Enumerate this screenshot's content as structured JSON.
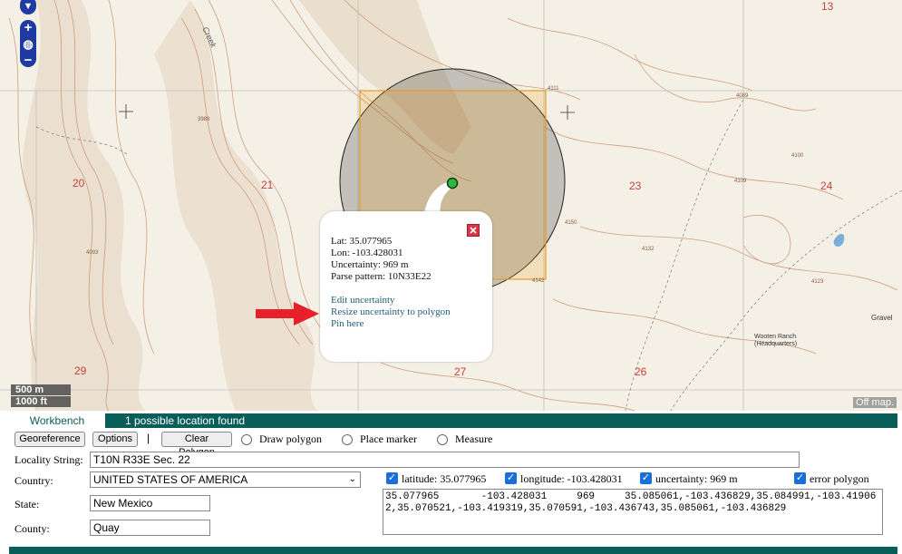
{
  "map": {
    "section_numbers": [
      "13",
      "20",
      "21",
      "23",
      "24",
      "29",
      "27",
      "26"
    ],
    "elevation_labels": [
      "3988",
      "4093",
      "4111",
      "4089",
      "4100",
      "4109",
      "4150",
      "4132",
      "4123",
      "4142"
    ],
    "place_labels": {
      "creek": "Creek",
      "ranch": "Wooten Ranch",
      "ranch_sub": "(Headquarters)",
      "gravel": "Gravel"
    },
    "scale_metric": "500 m",
    "scale_imperial": "1000 ft",
    "offmap_label": "Off map."
  },
  "popup": {
    "lat": "Lat: 35.077965",
    "lon": "Lon: -103.428031",
    "uncertainty": "Uncertainty: 969 m",
    "parse_pattern": "Parse pattern: 10N33E22",
    "edit_uncertainty": "Edit uncertainty",
    "resize_uncertainty": "Resize uncertainty to polygon",
    "pin_here": "Pin here"
  },
  "panel": {
    "tab_workbench": "Workbench",
    "status_message": "1 possible location found",
    "buttons": {
      "georeference": "Georeference",
      "options": "Options",
      "clear_polygon": "Clear Polygon"
    },
    "separator": "|",
    "radios": {
      "draw_polygon": "Draw polygon",
      "place_marker": "Place marker",
      "measure": "Measure"
    },
    "locality_label": "Locality String:",
    "locality_value": "T10N R33E Sec. 22",
    "country_label": "Country:",
    "country_value": "UNITED STATES OF AMERICA",
    "state_label": "State:",
    "state_value": "New Mexico",
    "county_label": "County:",
    "county_value": "Quay",
    "checks": {
      "latitude": "latitude: 35.077965",
      "longitude": "longitude: -103.428031",
      "uncertainty": "uncertainty: 969 m",
      "error_polygon": "error polygon"
    },
    "result_text": "35.077965\t-103.428031\t969\t35.085061,-103.436829,35.084991,-103.419062,35.070521,-103.419319,35.070591,-103.436743,35.085061,-103.436829"
  },
  "colors": {
    "accent_teal": "#0a5e5a",
    "link_blue": "#1f5a7a",
    "zoom_blue": "#1f3aa0",
    "contour_brown": "#c8906a",
    "uncertainty_orange": "#f0a020"
  }
}
